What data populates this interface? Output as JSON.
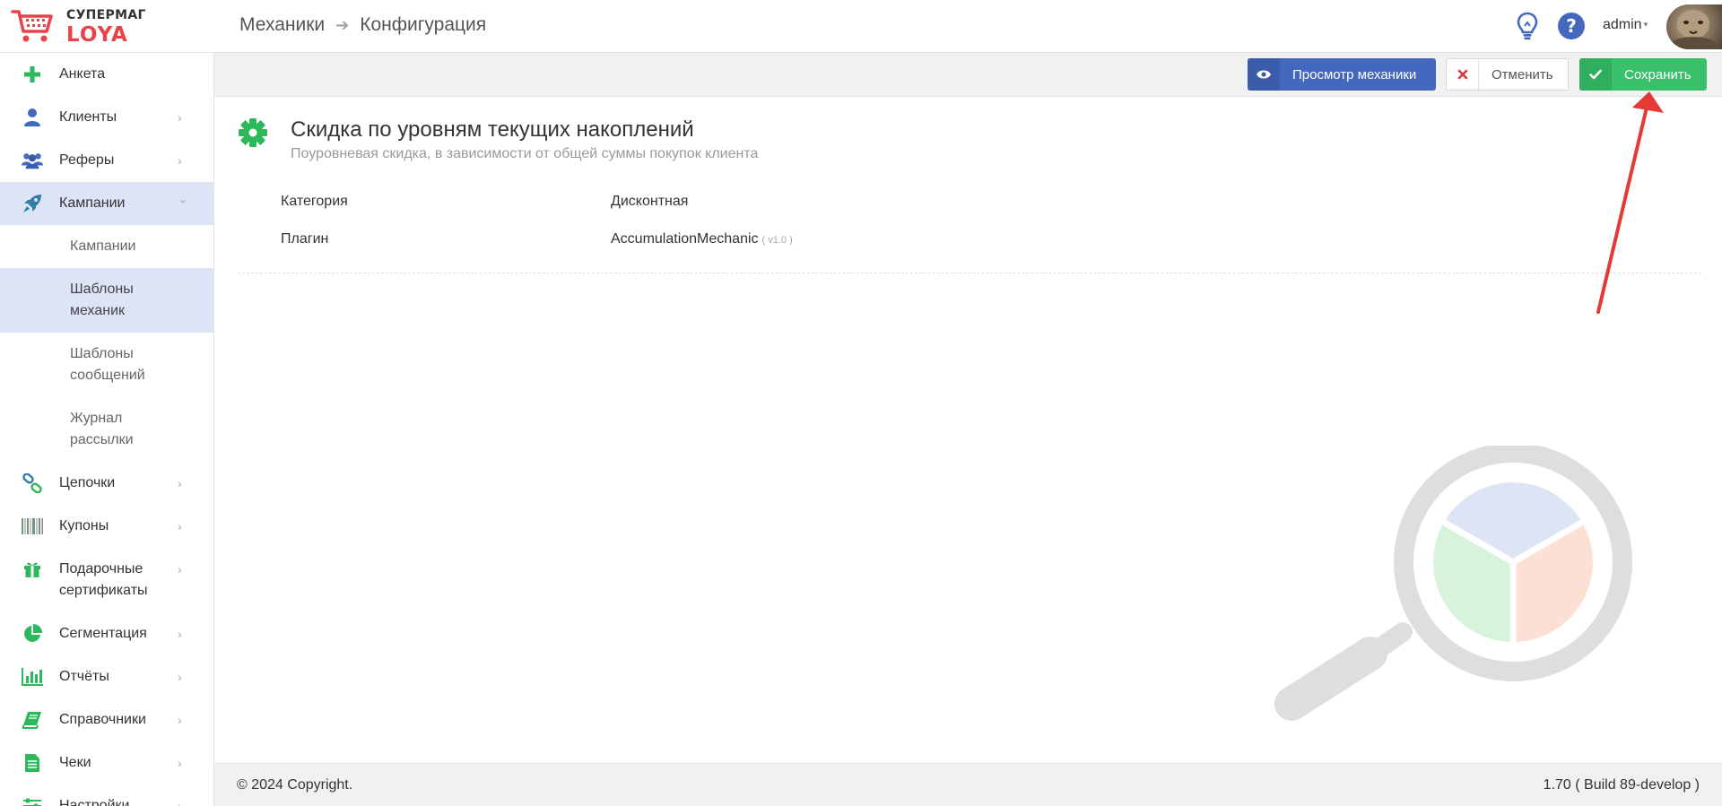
{
  "brand": {
    "top": "СУПЕРМАГ",
    "bottom": "LOYA"
  },
  "breadcrumb": {
    "parent": "Механики",
    "current": "Конфигурация",
    "separator": "➔"
  },
  "header": {
    "user": "admin",
    "caret": "▾"
  },
  "sidebar": {
    "items": [
      {
        "label": "Анкета"
      },
      {
        "label": "Клиенты"
      },
      {
        "label": "Реферы"
      },
      {
        "label": "Кампании"
      },
      {
        "label": "Цепочки"
      },
      {
        "label": "Купоны"
      },
      {
        "label": "Подарочные сертификаты"
      },
      {
        "label": "Сегментация"
      },
      {
        "label": "Отчёты"
      },
      {
        "label": "Справочники"
      },
      {
        "label": "Чеки"
      },
      {
        "label": "Настройки"
      }
    ],
    "subitems": [
      {
        "label": "Кампании"
      },
      {
        "label": "Шаблоны механик"
      },
      {
        "label": "Шаблоны сообщений"
      },
      {
        "label": "Журнал рассылки"
      }
    ],
    "chevron": "›",
    "chevron_open": "⌄"
  },
  "toolbar": {
    "view_label": "Просмотр механики",
    "cancel_label": "Отменить",
    "save_label": "Сохранить"
  },
  "mechanic": {
    "title": "Скидка по уровням текущих накоплений",
    "subtitle": "Поуровневая скидка, в зависимости от общей суммы покупок клиента",
    "properties": [
      {
        "key": "Категория",
        "value": "Дисконтная",
        "version": ""
      },
      {
        "key": "Плагин",
        "value": "AccumulationMechanic",
        "version": "( v1.0 )"
      }
    ]
  },
  "footer": {
    "copyright": "© 2024 Copyright.",
    "version": "1.70 ( Build 89-develop )"
  },
  "colors": {
    "accent_blue": "#4468be",
    "save_green": "#39c16a",
    "brand_red": "#e8434a",
    "active_bg": "#dde4f5",
    "annotation_red": "#e53935"
  }
}
